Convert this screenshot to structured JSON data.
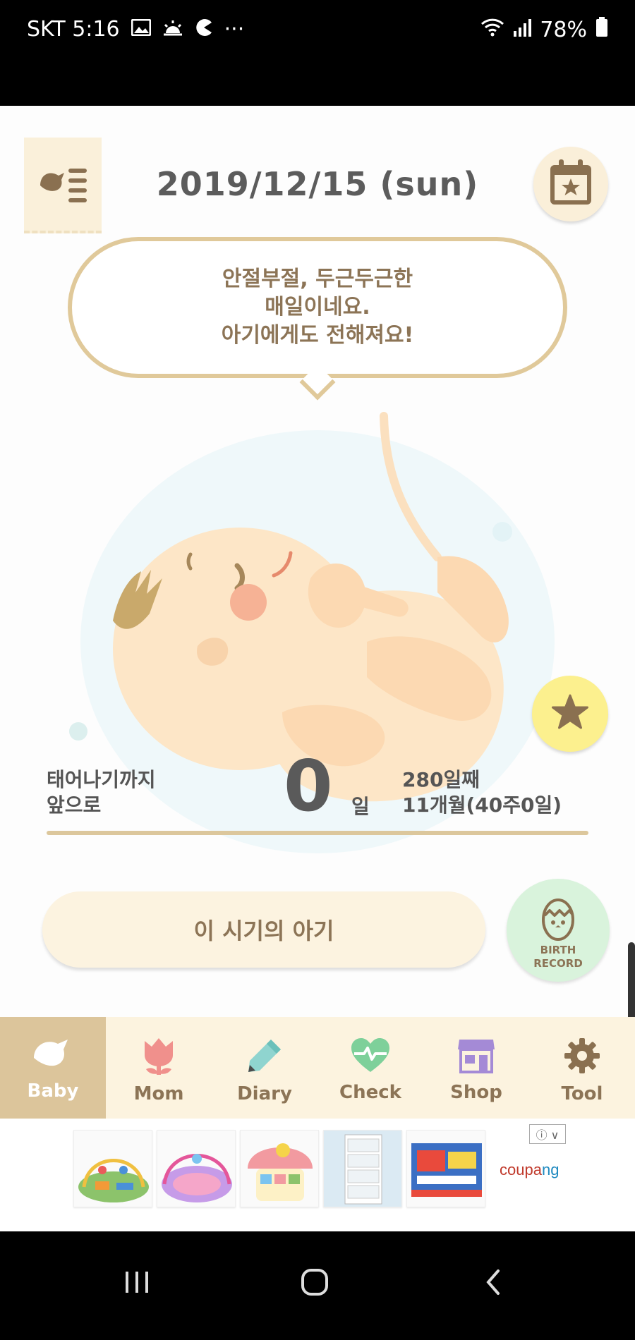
{
  "status_bar": {
    "carrier_time": "SKT 5:16",
    "more": "···",
    "battery": "78%",
    "icons": [
      "gallery-icon",
      "weather-icon",
      "pacman-icon",
      "wifi-icon",
      "signal-icon",
      "battery-icon"
    ]
  },
  "header": {
    "date": "2019/12/15 (sun)",
    "menu_icon": "bird-menu-icon",
    "calendar_icon": "calendar-star-icon"
  },
  "bubble": {
    "lines": [
      "안절부절, 두근두근한",
      "매일이네요.",
      "아기에게도 전해져요!"
    ]
  },
  "countdown": {
    "label_line1": "태어나기까지",
    "label_line2": "앞으로",
    "days": "0",
    "unit": "일",
    "right_line1": "280일째",
    "right_line2": "11개월(40주0일)"
  },
  "period_button": "이 시기의 아기",
  "birth_record": {
    "line1": "BIRTH",
    "line2": "RECORD"
  },
  "tabs": [
    {
      "label": "Baby",
      "icon": "bird-icon",
      "active": true
    },
    {
      "label": "Mom",
      "icon": "tulip-icon",
      "active": false
    },
    {
      "label": "Diary",
      "icon": "pencil-icon",
      "active": false
    },
    {
      "label": "Check",
      "icon": "heartbeat-icon",
      "active": false
    },
    {
      "label": "Shop",
      "icon": "store-icon",
      "active": false
    },
    {
      "label": "Tool",
      "icon": "gear-icon",
      "active": false
    }
  ],
  "ad": {
    "info": "ⓘ ∨",
    "brand_a": "coupa",
    "brand_b": "ng"
  },
  "colors": {
    "accent": "#dcc59b",
    "text_brown": "#8c7456",
    "tab_bg": "#fcf3df"
  }
}
